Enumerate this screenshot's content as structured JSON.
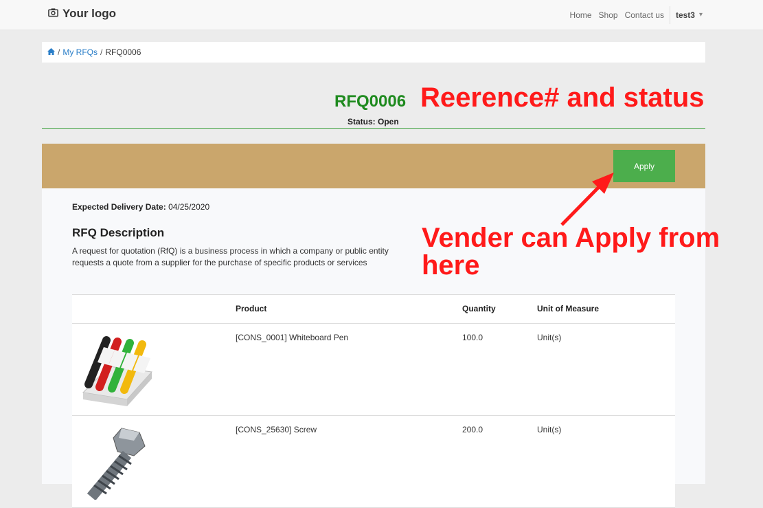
{
  "navbar": {
    "logo": "Your logo",
    "links": [
      "Home",
      "Shop",
      "Contact us"
    ],
    "user": "test3"
  },
  "breadcrumb": {
    "items": [
      "My RFQs"
    ],
    "current": "RFQ0006"
  },
  "rfq": {
    "number": "RFQ0006",
    "status": "Status: Open",
    "apply_label": "Apply",
    "delivery_label": "Expected Delivery Date:",
    "delivery_date": " 04/25/2020",
    "description_title": "RFQ Description",
    "description": "A request for quotation (RfQ) is a business process in which a company or public entity requests a quote from a supplier for the purchase of specific products or services"
  },
  "table": {
    "headers": [
      "Product",
      "Quantity",
      "Unit of Measure"
    ],
    "rows": [
      {
        "product": "[CONS_0001] Whiteboard Pen",
        "quantity": "100.0",
        "uom": "Unit(s)"
      },
      {
        "product": "[CONS_25630] Screw",
        "quantity": "200.0",
        "uom": "Unit(s)"
      }
    ]
  },
  "annotations": {
    "top": "Reerence# and status",
    "apply": "Vender can Apply from here"
  },
  "colors": {
    "banner": "#caa66c",
    "apply": "#4cae4c",
    "title_green": "#1e8a1e",
    "annotation_red": "#ff1a1a"
  }
}
